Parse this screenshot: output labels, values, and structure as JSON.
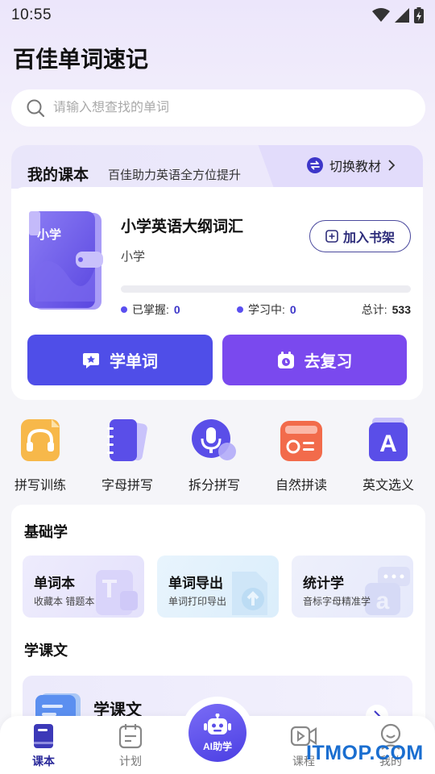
{
  "status_bar": {
    "time": "10:55"
  },
  "app": {
    "title": "百佳单词速记"
  },
  "search": {
    "placeholder": "请输入想查找的单词"
  },
  "book_card": {
    "title": "我的课本",
    "subtitle": "百佳助力英语全方位提升",
    "switch_label": "切换教材",
    "book_cover_label": "小学",
    "book_name": "小学英语大纲词汇",
    "book_level": "小学",
    "add_shelf_label": "加入书架",
    "progress_fraction": 0,
    "stats": {
      "mastered_label": "已掌握:",
      "mastered_value": "0",
      "learning_label": "学习中:",
      "learning_value": "0",
      "total_label": "总计:",
      "total_value": "533"
    },
    "learn_button": "学单词",
    "review_button": "去复习"
  },
  "features": [
    {
      "label": "拼写训练",
      "icon": "headphones-icon"
    },
    {
      "label": "字母拼写",
      "icon": "notebook-icon"
    },
    {
      "label": "拆分拼写",
      "icon": "microphone-icon"
    },
    {
      "label": "自然拼读",
      "icon": "radio-icon"
    },
    {
      "label": "英文选义",
      "icon": "letter-a-icon"
    }
  ],
  "basic": {
    "title": "基础学",
    "tiles": [
      {
        "title": "单词本",
        "desc": "收藏本 错题本"
      },
      {
        "title": "单词导出",
        "desc": "单词打印导出"
      },
      {
        "title": "统计学",
        "desc": "音标字母精准学"
      }
    ]
  },
  "lessons": {
    "title": "学课文",
    "card_title": "学课文"
  },
  "tabbar": {
    "items": [
      {
        "label": "课本"
      },
      {
        "label": "计划"
      },
      {
        "label": "AI助学"
      },
      {
        "label": "课程"
      },
      {
        "label": "我的"
      }
    ]
  },
  "watermark": "ITMOP.COM",
  "colors": {
    "primary": "#4f4ee8",
    "secondary": "#7a49ee",
    "accent_dark": "#2b2a9a"
  }
}
